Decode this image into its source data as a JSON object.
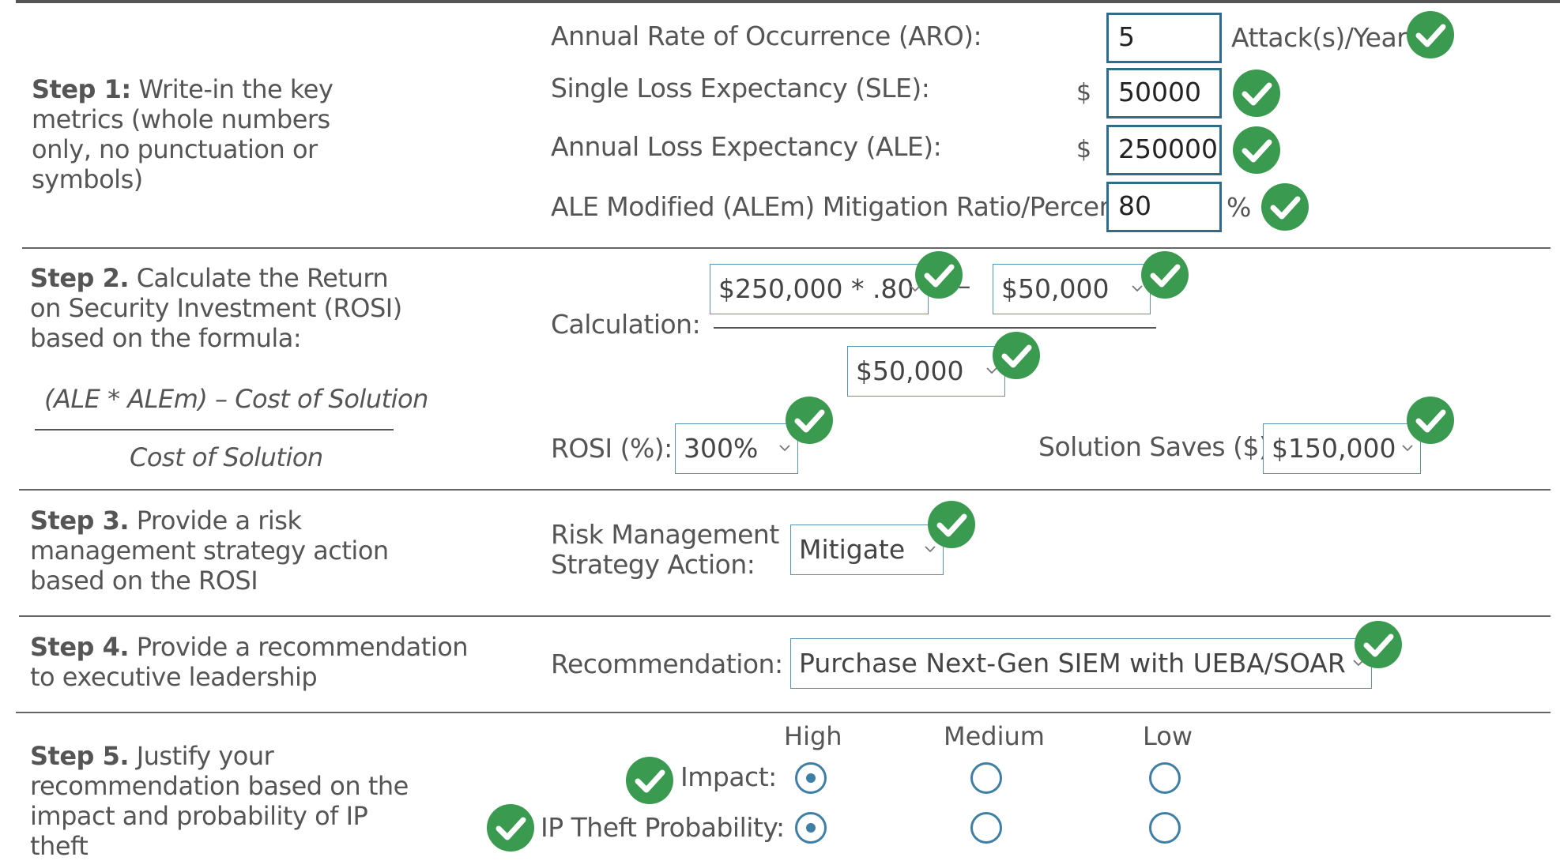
{
  "step1": {
    "num": "Step 1:",
    "text": "Write-in the key metrics (whole numbers only, no punctuation or symbols)",
    "aro_label": "Annual Rate of Occurrence (ARO):",
    "aro_value": "5",
    "aro_unit": "Attack(s)/Year",
    "sle_label": "Single Loss Expectancy (SLE):",
    "sle_currency": "$",
    "sle_value": "50000",
    "ale_label": "Annual Loss Expectancy (ALE):",
    "ale_currency": "$",
    "ale_value": "250000",
    "alem_label": "ALE Modified (ALEm) Mitigation Ratio/Percent:",
    "alem_value": "80",
    "alem_unit": "%"
  },
  "step2": {
    "num": "Step 2.",
    "text": "Calculate the Return on Security Investment (ROSI) based on the formula:",
    "formula_numerator": "(ALE * ALEm) – Cost of Solution",
    "formula_denominator": "Cost of Solution",
    "calc_label": "Calculation:",
    "calc_term1": "$250,000 * .80",
    "calc_minus": "–",
    "calc_term2": "$50,000",
    "calc_denominator": "$50,000",
    "rosi_label": "ROSI (%):",
    "rosi_value": "300%",
    "saves_label": "Solution Saves ($):",
    "saves_value": "$150,000"
  },
  "step3": {
    "num": "Step 3.",
    "text": "Provide a risk management strategy action based on the ROSI",
    "label": "Risk Management Strategy Action:",
    "value": "Mitigate"
  },
  "step4": {
    "num": "Step 4.",
    "text": "Provide a recommendation to executive leadership",
    "label": "Recommendation:",
    "value": "Purchase Next-Gen SIEM with UEBA/SOAR"
  },
  "step5": {
    "num": "Step 5.",
    "text": "Justify your recommendation based on the impact and probability of IP theft",
    "columns": [
      "High",
      "Medium",
      "Low"
    ],
    "impact_label": "Impact:",
    "probability_label": "IP Theft Probability:",
    "impact_selected": "High",
    "probability_selected": "High"
  },
  "colors": {
    "check_green": "#3a9a4f",
    "input_border": "#2f6b8c",
    "select_border": "#5b93b5",
    "radio": "#3d7fa6"
  }
}
